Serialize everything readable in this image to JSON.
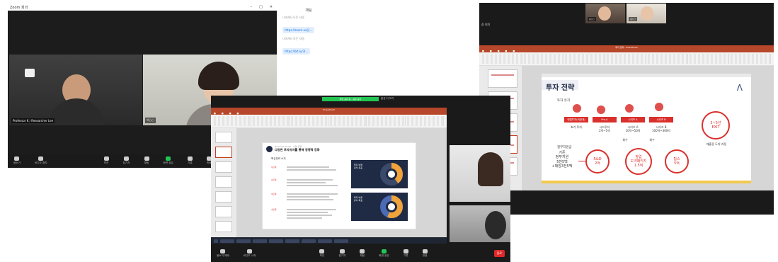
{
  "win1": {
    "title": "Zoom 회의",
    "participants": [
      {
        "name": "Professor K / Researcher Lee"
      },
      {
        "name": "이○○"
      }
    ],
    "toolbar": [
      "음소거",
      "비디오 중지",
      "보안",
      "참가자",
      "채팅",
      "화면 공유",
      "기록",
      "반응"
    ]
  },
  "chat": {
    "title": "채팅",
    "messages": [
      {
        "meta": "나에게서 모든 사람:",
        "text": "https://zoom.us/j/..."
      },
      {
        "meta": "나에게서 모든 사람:",
        "text": "https://bit.ly/3l..."
      }
    ]
  },
  "win2": {
    "share_bar": "화면 공유 중 · 공유 중지",
    "share_label": "옵션 더 보기",
    "ppt_title": "PowerPoint",
    "slide": {
      "subtitle": "Business Model · 사업 모델",
      "title": "다양한 투자유치를 통해 경쟁력 강화",
      "section": "핵심전략 소개",
      "rows": [
        "1단계",
        "2단계",
        "3단계",
        "4단계"
      ],
      "chart_labels": [
        [
          "투자 비율",
          "유치 목표"
        ],
        [
          "투자 비율",
          "유치 목표"
        ]
      ]
    },
    "toolbar": [
      "음소거 해제",
      "비디오 시작",
      "보안",
      "참가자",
      "채팅",
      "화면 공유",
      "기록",
      "반응"
    ],
    "leave": "종료"
  },
  "win3": {
    "zoom_label": "줌 회의",
    "participants": [
      {
        "name": "홍○○"
      },
      {
        "name": "김○○"
      }
    ],
    "ppt_title": "투자 전략 - PowerPoint",
    "slide": {
      "title": "투자 전략",
      "logo": "Λ",
      "section1": "투자 유치",
      "section2": "정부지원금",
      "boxes": [
        "엔젤투자(비공개)",
        "Pre-A",
        "시리즈 A",
        "시리즈 B"
      ],
      "under1": "초기 투자",
      "under2": [
        "엔젤투자",
        "1억~3억"
      ],
      "under3": [
        "시드투자",
        "2억~5억"
      ],
      "under4": [
        "시리즈 A",
        "10억~50억"
      ],
      "under5": [
        "시리즈 B",
        "100억~300억"
      ],
      "exit": [
        "3~5년",
        "EXIT"
      ],
      "exit_note": "매출증 도약 과정",
      "round_labels": [
        "회수",
        "회수"
      ],
      "gov": [
        "기존",
        "정부지원",
        "5천5백",
        "+매칭3천5백"
      ],
      "circles": [
        [
          "R&D",
          "2억"
        ],
        [
          "창업",
          "도약패키지",
          "1.5억"
        ],
        [
          "팁스",
          "5억"
        ]
      ]
    }
  }
}
